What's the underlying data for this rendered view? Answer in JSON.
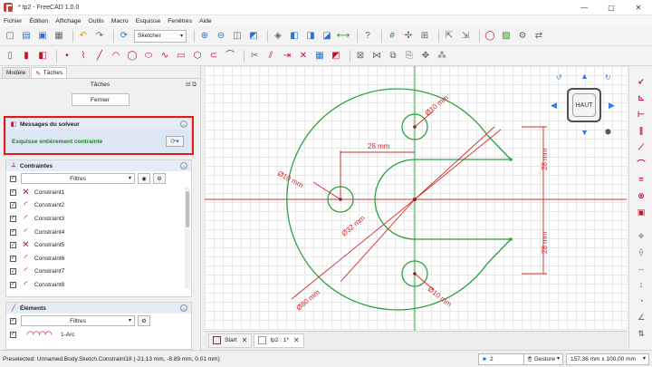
{
  "window": {
    "title": "* tp2 - FreeCAD 1.0.0",
    "minimize": "—",
    "maximize": "▢",
    "close": "✕"
  },
  "menu": [
    "Fichier",
    "Édition",
    "Affichage",
    "Outils",
    "Macro",
    "Esquisse",
    "Fenêtres",
    "Aide"
  ],
  "toolbar": {
    "workbench": "Sketcher"
  },
  "combo": {
    "tabs": [
      "Modèle",
      "Tâches"
    ],
    "task_header": "Tâches",
    "close_button": "Fermer"
  },
  "solver": {
    "title": "Messages du solveur",
    "message": "Esquisse entièrement contrainte"
  },
  "constraints": {
    "title": "Contraintes",
    "filter": "Filtres",
    "items": [
      "Constraint1",
      "Constraint2",
      "Constraint3",
      "Constraint4",
      "Constraint5",
      "Constraint6",
      "Constraint7",
      "Constraint8"
    ]
  },
  "elements": {
    "title": "Éléments",
    "filter": "Filtres",
    "items": [
      "1-Arc"
    ]
  },
  "view": {
    "navcube_face": "HAUT",
    "dimensions": {
      "d_top_hole": "Ø10 mm",
      "d_left_hole": "Ø10 mm",
      "d_bottom_hole": "Ø10 mm",
      "d_center": "Ø32 mm",
      "d_outer": "Ø80 mm",
      "horiz": "28 mm",
      "vert_top": "28 mm",
      "vert_bottom": "28 mm"
    }
  },
  "doc_tabs": [
    "Start",
    "tp2 : 1*"
  ],
  "status": {
    "preselected": "Preselected: Unnamed.Body.Sketch.Constraint18 (-21.13 mm, -8.89 mm, 0.01 mm)",
    "layer": "2",
    "nav_style": "Gesture",
    "dimensions": "157,36 mm x 100,00 mm"
  },
  "colors": {
    "geometry": "#2ea043",
    "dimension": "#d42a2a",
    "annotation": "#e01919"
  }
}
